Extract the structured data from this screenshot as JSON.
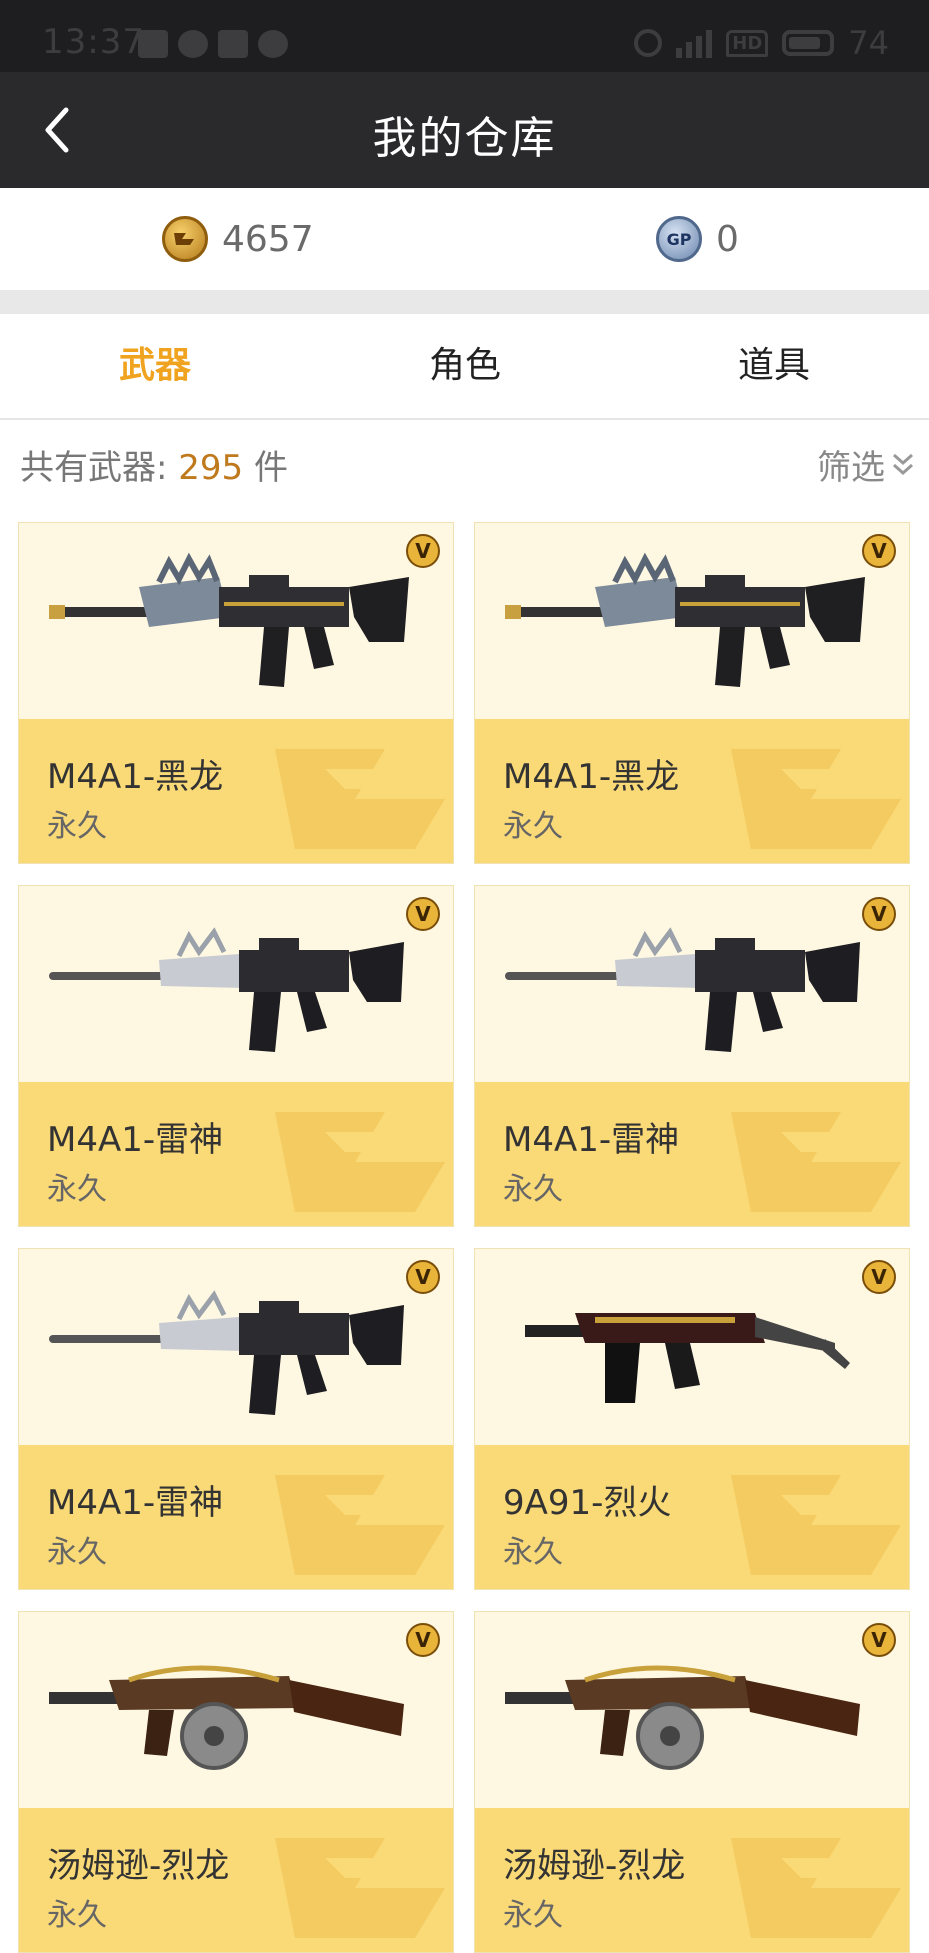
{
  "status_bar": {
    "time": "13:37",
    "battery": "74"
  },
  "nav": {
    "title": "我的仓库"
  },
  "currency": {
    "cf_amount": "4657",
    "gp_amount": "0",
    "cf_icon": "cf-coin-icon",
    "gp_icon": "gp-coin-icon",
    "gp_label": "GP"
  },
  "tabs": [
    {
      "label": "武器",
      "active": true
    },
    {
      "label": "角色",
      "active": false
    },
    {
      "label": "道具",
      "active": false
    }
  ],
  "summary": {
    "prefix": "共有武器:",
    "count": "295",
    "unit": "件"
  },
  "filter": {
    "label": "筛选"
  },
  "items": [
    {
      "name": "M4A1-黑龙",
      "duration": "永久",
      "weapon_type": "rifle-dragon"
    },
    {
      "name": "M4A1-黑龙",
      "duration": "永久",
      "weapon_type": "rifle-dragon"
    },
    {
      "name": "M4A1-雷神",
      "duration": "永久",
      "weapon_type": "rifle-thor"
    },
    {
      "name": "M4A1-雷神",
      "duration": "永久",
      "weapon_type": "rifle-thor"
    },
    {
      "name": "M4A1-雷神",
      "duration": "永久",
      "weapon_type": "rifle-thor"
    },
    {
      "name": "9A91-烈火",
      "duration": "永久",
      "weapon_type": "smg-9a91"
    },
    {
      "name": "汤姆逊-烈龙",
      "duration": "永久",
      "weapon_type": "tommy-gun"
    },
    {
      "name": "汤姆逊-烈龙",
      "duration": "永久",
      "weapon_type": "tommy-gun"
    }
  ]
}
